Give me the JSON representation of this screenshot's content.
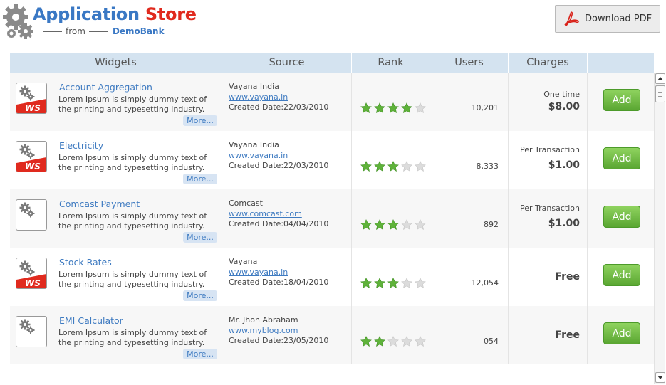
{
  "header": {
    "title_part1": "Application",
    "title_part2": "Store",
    "subtitle_from": "from",
    "subtitle_brand": "DemoBank",
    "download_pdf_label": "Download PDF"
  },
  "table": {
    "columns": [
      "Widgets",
      "Source",
      "Rank",
      "Users",
      "Charges",
      ""
    ],
    "rows": [
      {
        "widget_title": "Account Aggregation",
        "description": "Lorem Ipsum is simply dummy text of the printing and typesetting industry.",
        "more_label": "More...",
        "icon_badge": "WS",
        "source_name": "Vayana India",
        "source_link": "www.vayana.in",
        "created_date": "Created Date:22/03/2010",
        "rank_stars": 4,
        "users": "10,201",
        "charge_label": "One time",
        "charge_price": "$8.00",
        "add_label": "Add"
      },
      {
        "widget_title": "Electricity",
        "description": "Lorem Ipsum is simply dummy text of the printing and typesetting industry.",
        "more_label": "More...",
        "icon_badge": "WS",
        "source_name": "Vayana India",
        "source_link": "www.vayana.in",
        "created_date": "Created Date:22/03/2010",
        "rank_stars": 3,
        "users": "8,333",
        "charge_label": "Per Transaction",
        "charge_price": "$1.00",
        "add_label": "Add"
      },
      {
        "widget_title": "Comcast Payment",
        "description": "Lorem Ipsum is simply dummy text of the printing and typesetting industry.",
        "more_label": "More...",
        "icon_badge": "",
        "source_name": "Comcast",
        "source_link": "www.comcast.com",
        "created_date": "Created Date:04/04/2010",
        "rank_stars": 3,
        "users": "892",
        "charge_label": "Per Transaction",
        "charge_price": "$1.00",
        "add_label": "Add"
      },
      {
        "widget_title": "Stock Rates",
        "description": "Lorem Ipsum is simply dummy text of the printing and typesetting industry.",
        "more_label": "More...",
        "icon_badge": "WS",
        "source_name": "Vayana",
        "source_link": "www.vayana.in",
        "created_date": "Created Date:18/04/2010",
        "rank_stars": 3,
        "users": "12,054",
        "charge_label": "",
        "charge_price": "Free",
        "add_label": "Add"
      },
      {
        "widget_title": "EMI Calculator",
        "description": "Lorem Ipsum is simply dummy text of the printing and typesetting industry.",
        "more_label": "More...",
        "icon_badge": "",
        "source_name": "Mr. Jhon Abraham",
        "source_link": "www.myblog.com",
        "created_date": "Created Date:23/05/2010",
        "rank_stars": 2,
        "users": "054",
        "charge_label": "",
        "charge_price": "Free",
        "add_label": "Add"
      }
    ],
    "max_stars": 5
  },
  "colors": {
    "brand_blue": "#3a78c4",
    "brand_red": "#e02a1e",
    "star_on": "#5fb33a",
    "star_off": "#dcdcdc",
    "add_green": "#6dbb42"
  }
}
